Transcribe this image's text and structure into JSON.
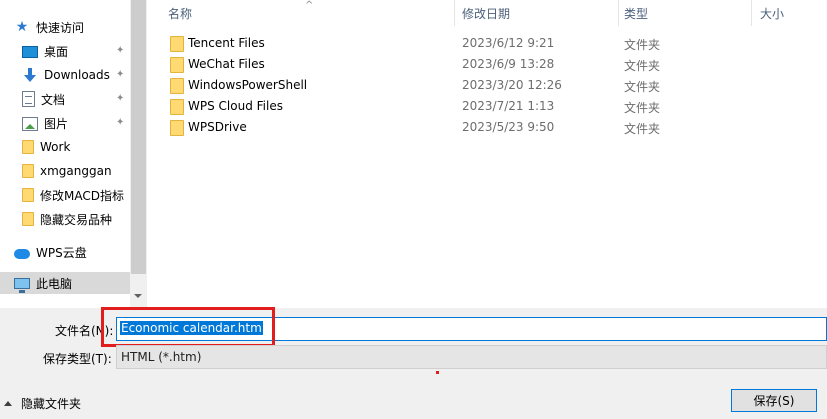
{
  "nav": {
    "items": [
      {
        "label": "快速访问",
        "icon": "star-icon",
        "pinned": false
      },
      {
        "label": "桌面",
        "icon": "desktop-icon",
        "pinned": true
      },
      {
        "label": "Downloads",
        "icon": "download-icon",
        "pinned": true
      },
      {
        "label": "文档",
        "icon": "document-icon",
        "pinned": true
      },
      {
        "label": "图片",
        "icon": "picture-icon",
        "pinned": true
      },
      {
        "label": "Work",
        "icon": "folder-icon",
        "pinned": false
      },
      {
        "label": "xmganggan",
        "icon": "folder-icon",
        "pinned": false
      },
      {
        "label": "修改MACD指标",
        "icon": "folder-icon",
        "pinned": false
      },
      {
        "label": "隐藏交易品种",
        "icon": "folder-icon",
        "pinned": false
      },
      {
        "label": "WPS云盘",
        "icon": "cloud-icon",
        "pinned": false
      },
      {
        "label": "此电脑",
        "icon": "pc-icon",
        "pinned": false,
        "selected": true
      }
    ],
    "pin_glyph": "✦"
  },
  "columns": {
    "name": "名称",
    "modified": "修改日期",
    "type": "类型",
    "size": "大小",
    "sort_glyph": "^"
  },
  "files": [
    {
      "name": "Tencent Files",
      "modified": "2023/6/12 9:21",
      "type": "文件夹"
    },
    {
      "name": "WeChat Files",
      "modified": "2023/6/9 13:28",
      "type": "文件夹"
    },
    {
      "name": "WindowsPowerShell",
      "modified": "2023/3/20 12:26",
      "type": "文件夹"
    },
    {
      "name": "WPS Cloud Files",
      "modified": "2023/7/21 1:13",
      "type": "文件夹"
    },
    {
      "name": "WPSDrive",
      "modified": "2023/5/23 9:50",
      "type": "文件夹"
    }
  ],
  "form": {
    "filename_label": "文件名(N):",
    "filename_value": "Economic calendar.htm",
    "filetype_label": "保存类型(T):",
    "filetype_value": "HTML (*.htm)",
    "hide_folders_label": "隐藏文件夹",
    "save_button": "保存(S)"
  },
  "colors": {
    "accent": "#0078d7",
    "highlight": "#e11d1d",
    "folder": "#ffd971"
  }
}
